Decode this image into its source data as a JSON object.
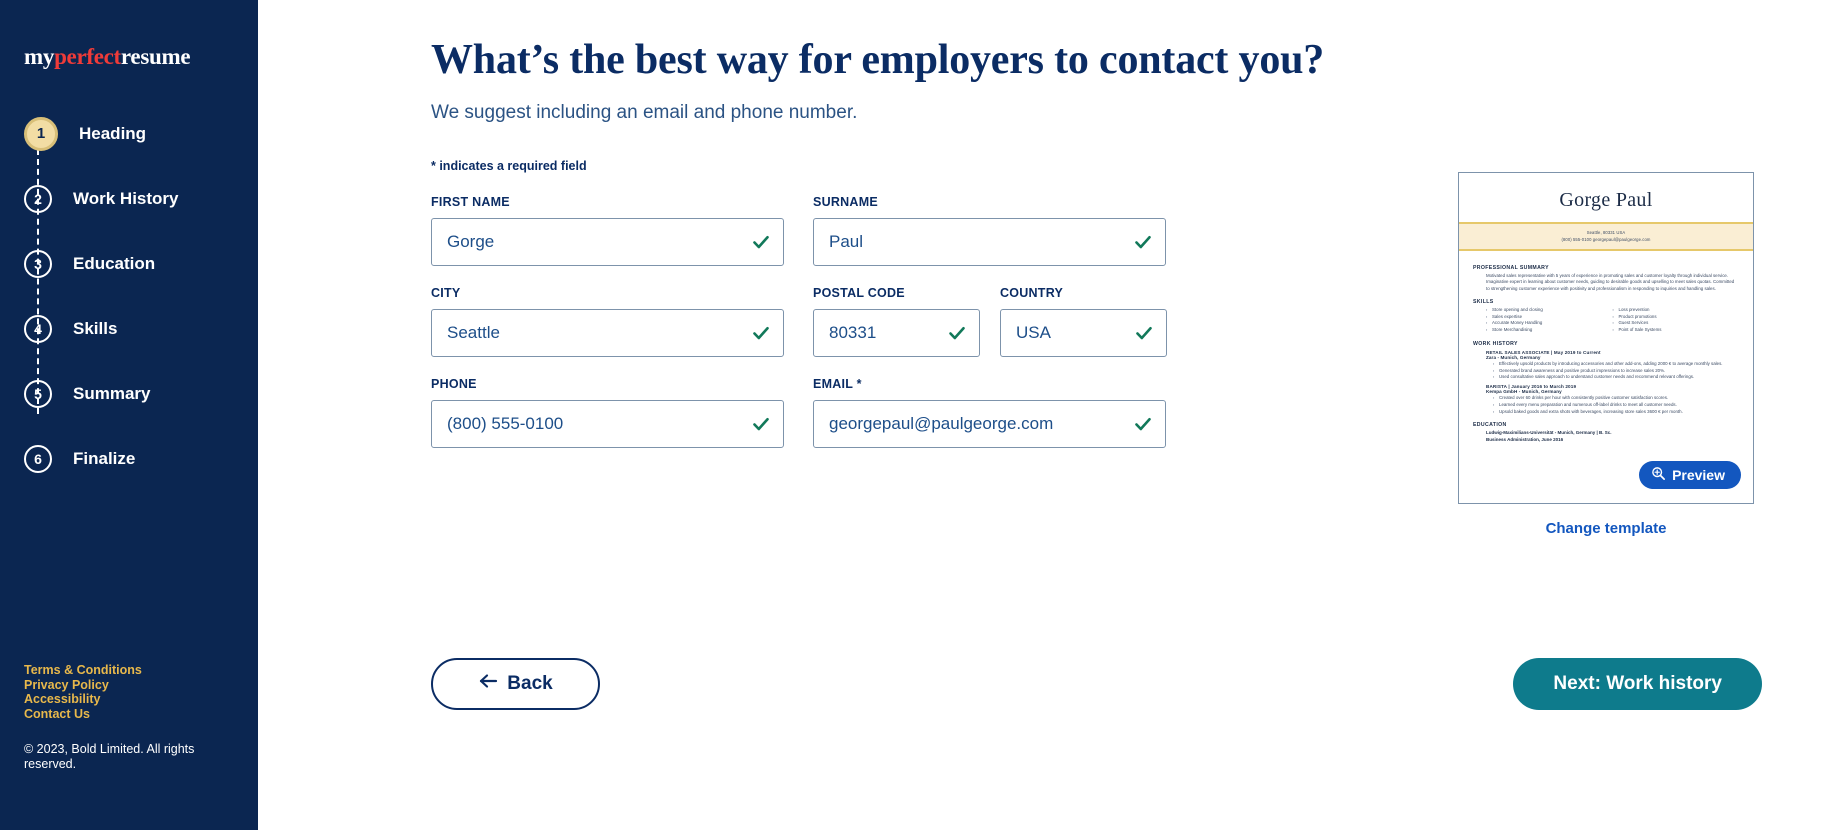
{
  "sidebar": {
    "logo": {
      "part1": "my",
      "accent": "perfect",
      "part3": "resume"
    },
    "steps": [
      {
        "num": "1",
        "label": "Heading",
        "active": true
      },
      {
        "num": "2",
        "label": "Work History",
        "active": false
      },
      {
        "num": "3",
        "label": "Education",
        "active": false
      },
      {
        "num": "4",
        "label": "Skills",
        "active": false
      },
      {
        "num": "5",
        "label": "Summary",
        "active": false
      },
      {
        "num": "6",
        "label": "Finalize",
        "active": false
      }
    ],
    "footer_links": [
      "Terms & Conditions",
      "Privacy Policy",
      "Accessibility",
      "Contact Us"
    ],
    "copyright": "© 2023, Bold Limited. All rights reserved."
  },
  "main": {
    "title": "What’s the best way for employers to contact you?",
    "subtitle": "We suggest including an email and phone number.",
    "required_note": "* indicates a required field",
    "fields": {
      "first_name": {
        "label": "FIRST NAME",
        "value": "Gorge",
        "placeholder": "First Name"
      },
      "surname": {
        "label": "SURNAME",
        "value": "Paul",
        "placeholder": "Surname"
      },
      "city": {
        "label": "CITY",
        "value": "Seattle",
        "placeholder": "City"
      },
      "postal_code": {
        "label": "POSTAL CODE",
        "value": "80331",
        "placeholder": "Postal Code"
      },
      "country": {
        "label": "COUNTRY",
        "value": "USA",
        "placeholder": "Country"
      },
      "phone": {
        "label": "PHONE",
        "value": "(800) 555-0100",
        "placeholder": "Phone"
      },
      "email": {
        "label": "EMAIL *",
        "value": "georgepaul@paulgeorge.com",
        "placeholder": "Email"
      }
    },
    "buttons": {
      "back": "Back",
      "next": "Next: Work history"
    }
  },
  "preview": {
    "button_label": "Preview",
    "change_template": "Change template",
    "resume": {
      "name": "Gorge Paul",
      "contact_line1": "Seattle, 80331 USA",
      "contact_line2": "(800) 555-0100 georgepaul@paulgeorge.com",
      "summary_title": "PROFESSIONAL SUMMARY",
      "summary_text": "Motivated sales representative with 5 years of experience in promoting sales and customer loyalty through individual service. Imaginative expert in learning about customer needs, guiding to desirable goods and upselling to meet sales quotas. Committed to strengthening customer experience with positivity and professionalism in responding to inquiries and handling sales.",
      "skills_title": "SKILLS",
      "skills_left": [
        "Store opening and closing",
        "Sales expertise",
        "Accurate Money Handling",
        "Store Merchandising"
      ],
      "skills_right": [
        "Loss prevention",
        "Product promotions",
        "Guest Services",
        "Point of Sale Systems"
      ],
      "work_title": "WORK HISTORY",
      "jobs": [
        {
          "title": "RETAIL SALES ASSOCIATE | May 2019 to Current",
          "company": "Zara - Munich, Germany",
          "bullets": [
            "Effectively upsold products by introducing accessories and other add-ons, adding 2000 € to average monthly sales.",
            "Generated brand awareness and positive product impressions to increase sales 20%.",
            "Used consultative sales approach to understand customer needs and recommend relevant offerings."
          ]
        },
        {
          "title": "BARISTA | January 2016 to March 2019",
          "company": "Kempa GmbH - Munich, Germany",
          "bullets": [
            "Created over 60 drinks per hour with consistently positive customer satisfaction scores.",
            "Learned every menu preparation and numerous off-label drinks to meet all customer needs.",
            "Upsold baked goods and extra shots with beverages, increasing store sales 3600 € per month."
          ]
        }
      ],
      "education_title": "EDUCATION",
      "education_line1": "Ludwig-Maximilians-Universität - Munich, Germany | B. Sc.",
      "education_line2": "Business Administration, June 2016"
    }
  },
  "colors": {
    "sidebar_bg": "#0b2651",
    "navy": "#0b2c64",
    "accent_red": "#ef3b39",
    "gold": "#e8b84b",
    "teal": "#0e7b8c",
    "blue_link": "#1357bf",
    "check_green": "#12795a"
  }
}
